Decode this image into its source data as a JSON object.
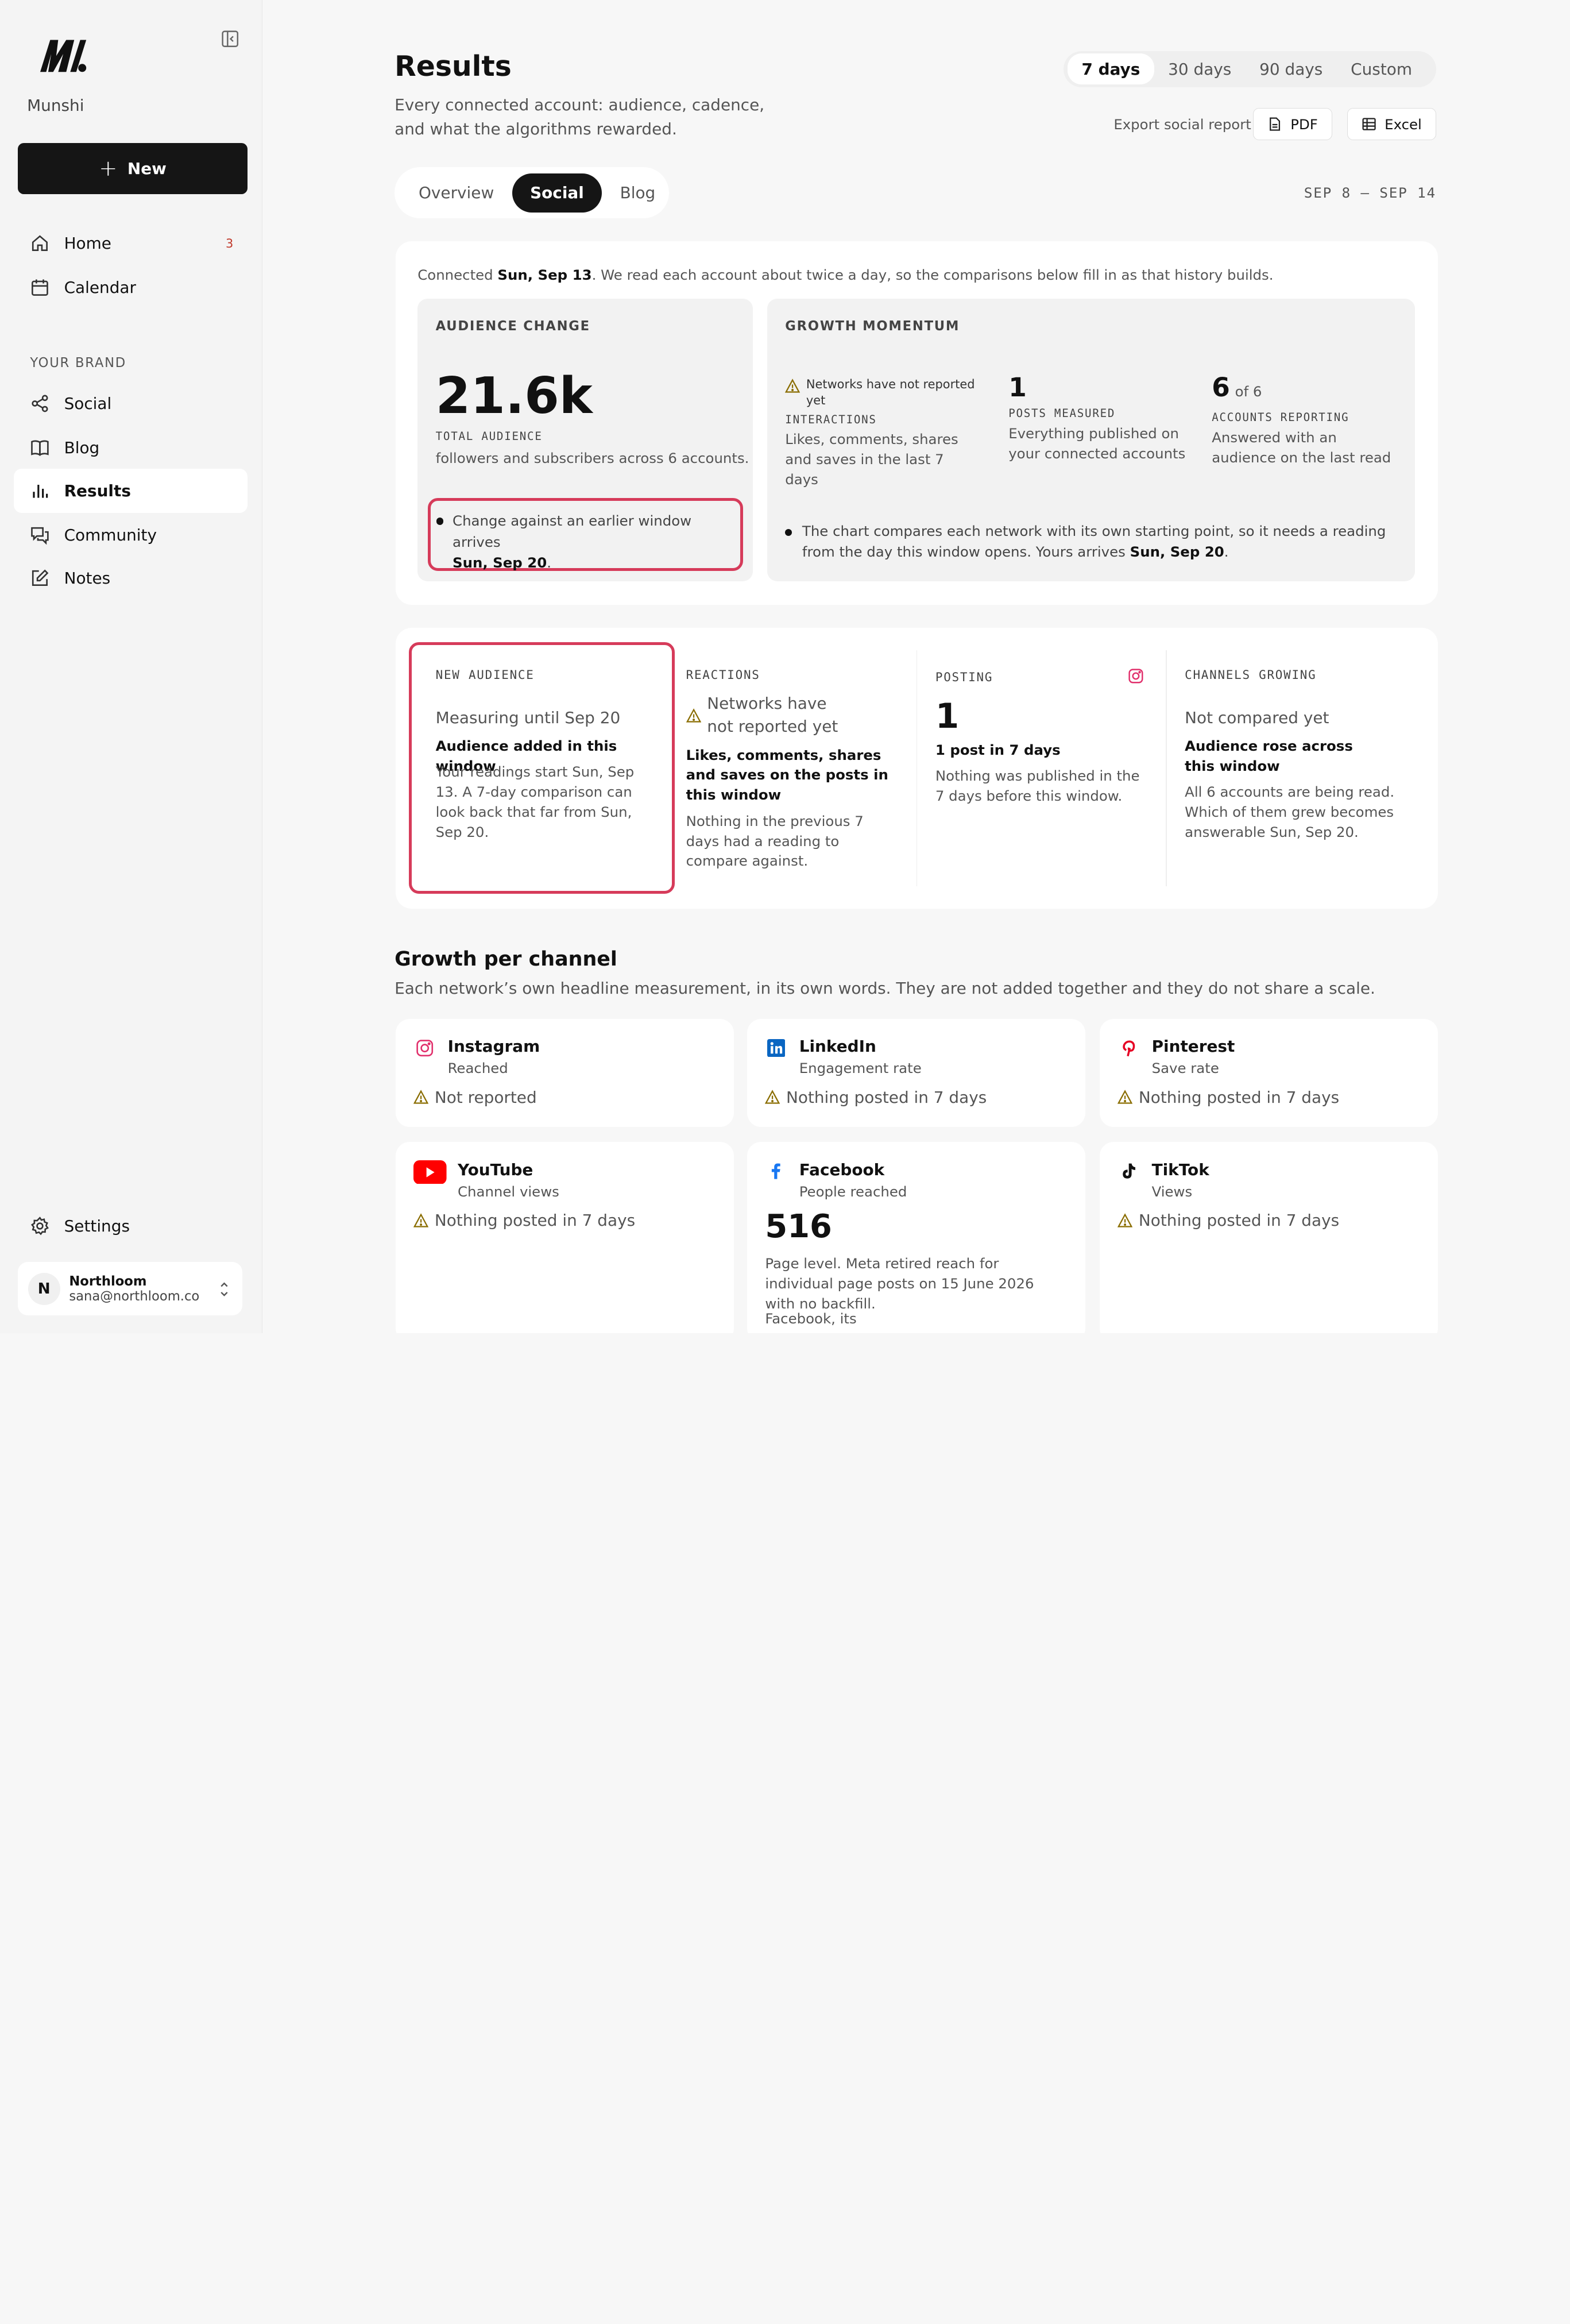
{
  "sidebar": {
    "brand": "Munshi",
    "new_label": "New",
    "nav": [
      {
        "label": "Home",
        "badge": "3"
      },
      {
        "label": "Calendar"
      }
    ],
    "section_label": "YOUR BRAND",
    "brand_nav": [
      {
        "label": "Social"
      },
      {
        "label": "Blog"
      },
      {
        "label": "Results",
        "active": true
      },
      {
        "label": "Community"
      },
      {
        "label": "Notes"
      }
    ],
    "settings_label": "Settings",
    "user": {
      "initial": "N",
      "name": "Northloom",
      "email": "sana@northloom.co"
    }
  },
  "header": {
    "title": "Results",
    "subtitle": "Every connected account: audience, cadence, and what the algorithms rewarded.",
    "range_tabs": [
      "7 days",
      "30 days",
      "90 days",
      "Custom"
    ],
    "active_range": "7 days",
    "export_label": "Export social report",
    "export_pdf": "PDF",
    "export_excel": "Excel",
    "view_tabs": [
      "Overview",
      "Social",
      "Blog"
    ],
    "active_view": "Social",
    "date_range": "SEP 8 – SEP 14"
  },
  "summary": {
    "connected_prefix": "Connected ",
    "connected_date": "Sun, Sep 13",
    "connected_suffix": ". We read each account about twice a day, so the comparisons below fill in as that history builds.",
    "audience": {
      "label": "AUDIENCE CHANGE",
      "value": "21.6k",
      "value_label": "TOTAL AUDIENCE",
      "desc": "followers and subscribers across 6 accounts.",
      "callout_text": "Change against an earlier window arrives",
      "callout_date": "Sun, Sep 20",
      "callout_end": "."
    },
    "momentum": {
      "label": "GROWTH MOMENTUM",
      "interactions_warning": "Networks have not reported yet",
      "interactions_label": "INTERACTIONS",
      "interactions_desc": "Likes, comments, shares and saves in the last 7 days",
      "posts_value": "1",
      "posts_label": "POSTS MEASURED",
      "posts_desc": "Everything published on your connected accounts",
      "accounts_value": "6",
      "accounts_of": "of 6",
      "accounts_label": "ACCOUNTS REPORTING",
      "accounts_desc": "Answered with an audience on the last read",
      "note_text": "The chart compares each network with its own starting point, so it needs a reading from the day this window opens. Yours arrives",
      "note_date": "Sun, Sep 20",
      "note_end": "."
    }
  },
  "kpis": {
    "new_audience": {
      "label": "NEW AUDIENCE",
      "status": "Measuring until Sep 20",
      "title": "Audience added in this window",
      "desc": "Your readings start Sun, Sep 13. A 7-day comparison can look back that far from Sun, Sep 20."
    },
    "reactions": {
      "label": "REACTIONS",
      "warning": "Networks have not reported yet",
      "title": "Likes, comments, shares and saves on the posts in this window",
      "desc": "Nothing in the previous 7 days had a reading to compare against."
    },
    "posting": {
      "label": "POSTING",
      "value": "1",
      "title": "1 post in 7 days",
      "desc": "Nothing was published in the 7 days before this window."
    },
    "channels": {
      "label": "CHANNELS GROWING",
      "status": "Not compared yet",
      "title": "Audience rose across this window",
      "desc": "All 6 accounts are being read. Which of them grew becomes answerable Sun, Sep 20."
    }
  },
  "growth": {
    "title": "Growth per channel",
    "subtitle": "Each network’s own headline measurement, in its own words. They are not added together and they do not share a scale.",
    "channels": [
      {
        "name": "Instagram",
        "metric": "Reached",
        "status": "Not reported",
        "icon": "instagram-icon",
        "color": "#e1306c"
      },
      {
        "name": "LinkedIn",
        "metric": "Engagement rate",
        "status": "Nothing posted in 7 days",
        "icon": "linkedin-icon",
        "color": "#0a66c2"
      },
      {
        "name": "Pinterest",
        "metric": "Save rate",
        "status": "Nothing posted in 7 days",
        "icon": "pinterest-icon",
        "color": "#e60023"
      },
      {
        "name": "YouTube",
        "metric": "Channel views",
        "status": "Nothing posted in 7 days",
        "icon": "youtube-icon",
        "color": "#ff0000"
      },
      {
        "name": "Facebook",
        "metric": "People reached",
        "value": "516",
        "desc": "Page level. Meta retired reach for individual page posts on 15 June 2026 with no backfill.",
        "desc2": "Facebook, its",
        "icon": "facebook-icon",
        "color": "#1877f2"
      },
      {
        "name": "TikTok",
        "metric": "Views",
        "status": "Nothing posted in 7 days",
        "icon": "tiktok-icon",
        "color": "#111111"
      }
    ]
  },
  "colors": {
    "accent_dark": "#151515",
    "highlight": "#d63b5a",
    "badge": "#c0392b"
  }
}
